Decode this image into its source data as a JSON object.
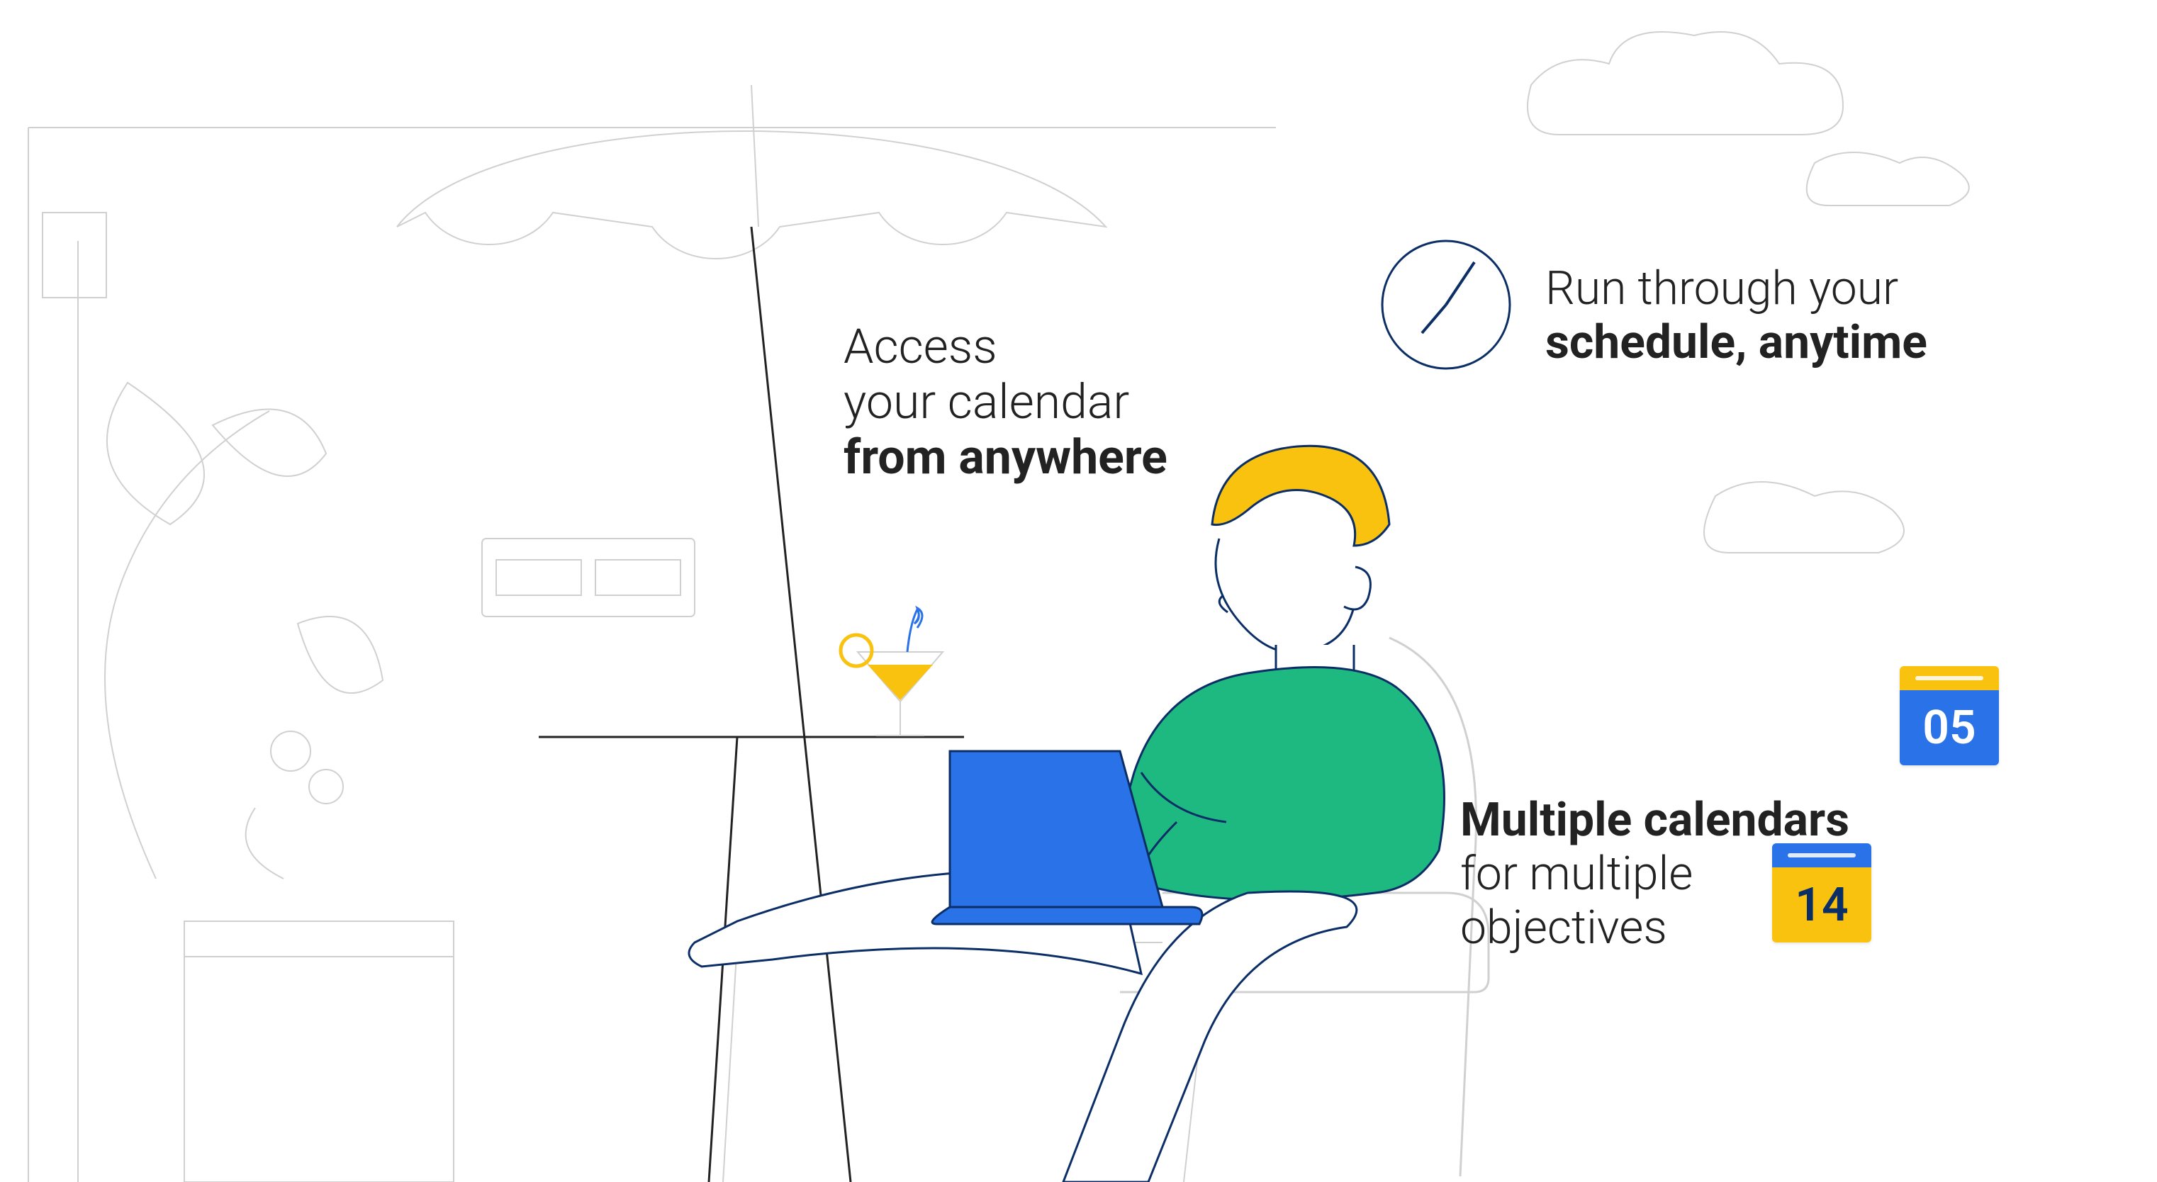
{
  "captions": {
    "access": {
      "line1": "Access",
      "line2": "your calendar",
      "line3": "from anywhere"
    },
    "schedule": {
      "line1": "Run through your",
      "line2": "schedule, anytime"
    },
    "multiple": {
      "line1": "Multiple calendars",
      "line2": "for multiple",
      "line3": "objectives"
    }
  },
  "calendar_badges": {
    "blue_day": "05",
    "yellow_day": "14"
  },
  "colors": {
    "navy": "#0b2e66",
    "blue": "#2a72e8",
    "yellow": "#f8c20f",
    "green": "#1eb980",
    "outline_grey": "#d0d0d0",
    "text": "#222222"
  },
  "illustration": {
    "description": "Person with yellow hair and green shirt sitting on a chair with a blue laptop, at a small table with a cocktail glass, under a beach umbrella. Surrounding background line-art: potted plant left, planter box, wall lines, clouds, air-conditioner/window unit.",
    "elements": [
      "beach-umbrella",
      "table",
      "cocktail-glass",
      "laptop",
      "person",
      "chair",
      "potted-plant",
      "planter-box",
      "clouds",
      "wall-lines",
      "clock-icon"
    ]
  }
}
